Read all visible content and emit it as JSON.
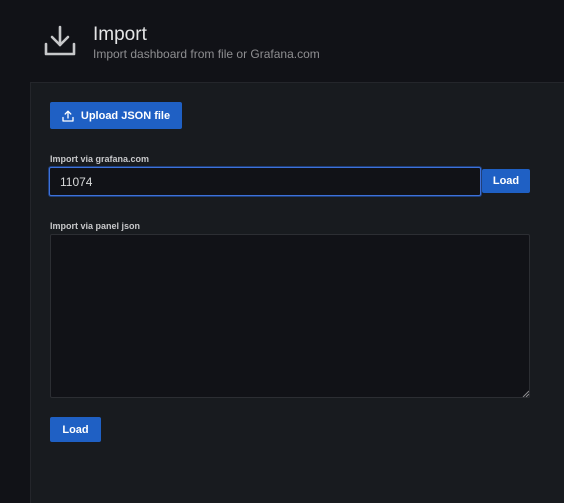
{
  "header": {
    "title": "Import",
    "subtitle": "Import dashboard from file or Grafana.com",
    "icon": "download-icon"
  },
  "upload": {
    "label": "Upload JSON file",
    "icon": "upload-icon"
  },
  "grafana_import": {
    "label": "Import via grafana.com",
    "value": "11074",
    "load_label": "Load"
  },
  "panel_json": {
    "label": "Import via panel json",
    "value": ""
  },
  "footer": {
    "load_label": "Load"
  },
  "colors": {
    "background": "#111217",
    "panel": "#181b1f",
    "primary_button": "#1f60c4",
    "focus_border": "#3d71d9"
  }
}
